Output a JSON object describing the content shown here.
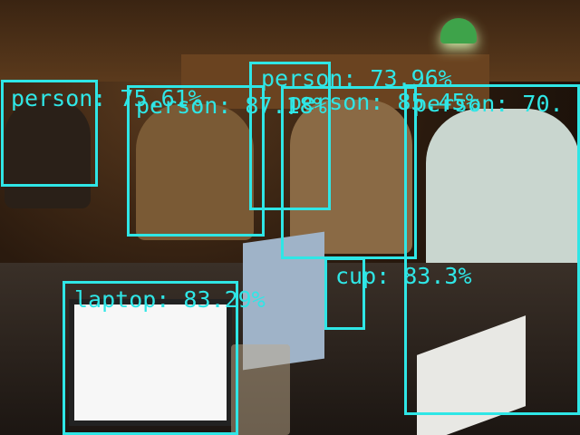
{
  "detections": [
    {
      "label": "person: 75.61%"
    },
    {
      "label": "person: 87.18%"
    },
    {
      "label": "person: 73.96%"
    },
    {
      "label": "person: 85.45%"
    },
    {
      "label": "person: 70."
    },
    {
      "label": "cup: 83.3%"
    },
    {
      "label": "laptop: 83.29%"
    }
  ],
  "colors": {
    "box": "#2fe6e6"
  }
}
